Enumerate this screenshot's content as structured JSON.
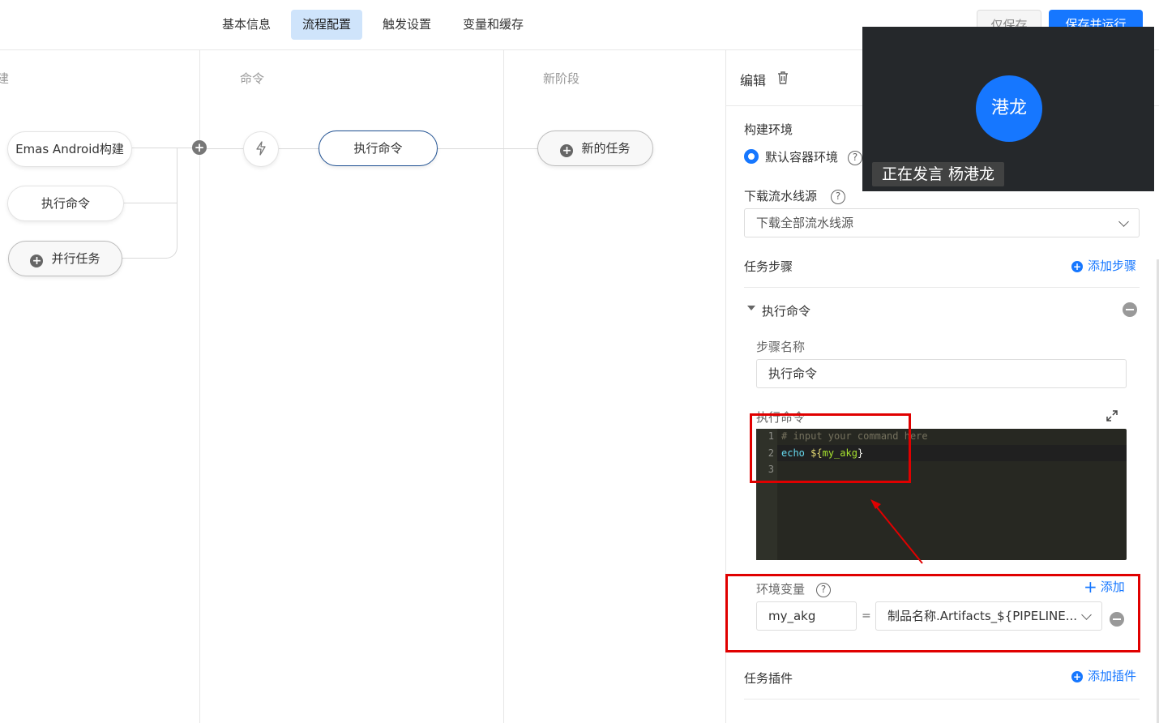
{
  "tabs": [
    {
      "label": "基本信息"
    },
    {
      "label": "流程配置"
    },
    {
      "label": "触发设置"
    },
    {
      "label": "变量和缓存"
    }
  ],
  "header_buttons": {
    "save_only": "仅保存",
    "save_run": "保存并运行"
  },
  "stages": {
    "stage1_partial": "建",
    "stage2": "命令",
    "stage3": "新阶段"
  },
  "nodes": {
    "emas": "Emas Android构建",
    "exec_left": "执行命令",
    "parallel": "并行任务",
    "exec_selected": "执行命令",
    "new_task": "新的任务"
  },
  "panel": {
    "title": "编辑",
    "build_env_label": "构建环境",
    "build_env_option": "默认容器环境",
    "download_label": "下载流水线源",
    "download_value": "下载全部流水线源",
    "steps_label": "任务步骤",
    "add_step": "添加步骤",
    "step_name_header": "执行命令",
    "step_name_label": "步骤名称",
    "step_name_value": "执行命令",
    "command_label": "执行命令",
    "env_label": "环境变量",
    "env_add": "添加",
    "env_key": "my_akg",
    "env_eq": "=",
    "env_value": "制品名称.Artifacts_${PIPELINE...",
    "plugins_label": "任务插件",
    "add_plugin": "添加插件"
  },
  "editor": {
    "line_numbers": [
      "1",
      "2",
      "3"
    ],
    "line1": "# input your command here",
    "line2_cmd": "echo",
    "line2_open": "${",
    "line2_var": "my_akg",
    "line2_close": "}"
  },
  "video": {
    "avatar_name": "港龙",
    "speaking_text": "正在发言 杨港龙"
  },
  "colors": {
    "accent": "#1677ff",
    "annotation": "#e00000",
    "editor_bg": "#272822"
  }
}
